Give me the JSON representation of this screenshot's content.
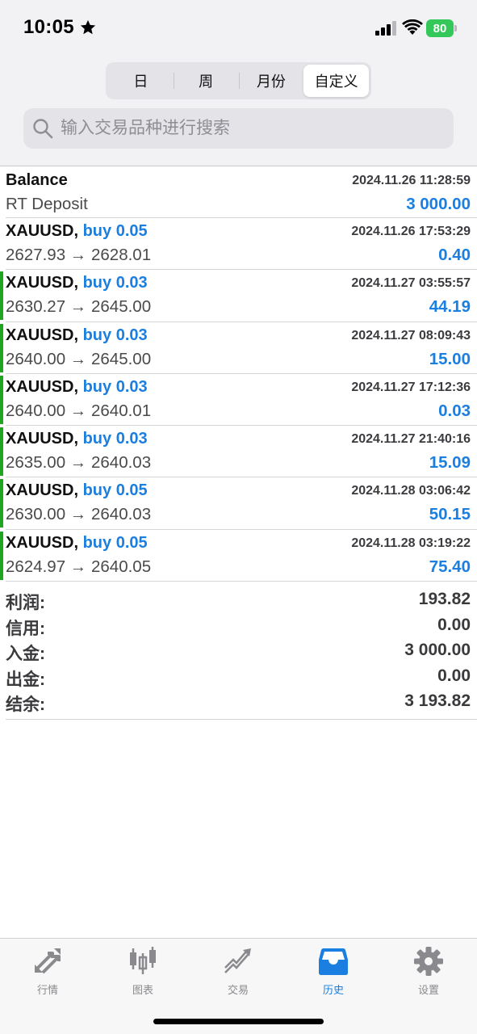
{
  "status": {
    "time": "10:05",
    "battery": "80"
  },
  "segments": [
    {
      "label": "日",
      "active": false
    },
    {
      "label": "周",
      "active": false
    },
    {
      "label": "月份",
      "active": false
    },
    {
      "label": "自定义",
      "active": true
    }
  ],
  "search": {
    "placeholder": "输入交易品种进行搜索",
    "value": ""
  },
  "balance_row": {
    "title": "Balance",
    "subtitle": "RT Deposit",
    "time": "2024.11.26 11:28:59",
    "value": "3 000.00"
  },
  "trades": [
    {
      "symbol": "XAUUSD,",
      "side": "buy 0.05",
      "prices": "2627.93 → 2628.01",
      "time": "2024.11.26 17:53:29",
      "profit": "0.40",
      "marked": false
    },
    {
      "symbol": "XAUUSD,",
      "side": "buy 0.03",
      "prices": "2630.27 → 2645.00",
      "time": "2024.11.27 03:55:57",
      "profit": "44.19",
      "marked": true
    },
    {
      "symbol": "XAUUSD,",
      "side": "buy 0.03",
      "prices": "2640.00 → 2645.00",
      "time": "2024.11.27 08:09:43",
      "profit": "15.00",
      "marked": true
    },
    {
      "symbol": "XAUUSD,",
      "side": "buy 0.03",
      "prices": "2640.00 → 2640.01",
      "time": "2024.11.27 17:12:36",
      "profit": "0.03",
      "marked": true
    },
    {
      "symbol": "XAUUSD,",
      "side": "buy 0.03",
      "prices": "2635.00 → 2640.03",
      "time": "2024.11.27 21:40:16",
      "profit": "15.09",
      "marked": true
    },
    {
      "symbol": "XAUUSD,",
      "side": "buy 0.05",
      "prices": "2630.00 → 2640.03",
      "time": "2024.11.28 03:06:42",
      "profit": "50.15",
      "marked": true
    },
    {
      "symbol": "XAUUSD,",
      "side": "buy 0.05",
      "prices": "2624.97 → 2640.05",
      "time": "2024.11.28 03:19:22",
      "profit": "75.40",
      "marked": true
    }
  ],
  "summary": [
    {
      "label": "利润:",
      "value": "193.82"
    },
    {
      "label": "信用:",
      "value": "0.00"
    },
    {
      "label": "入金:",
      "value": "3 000.00"
    },
    {
      "label": "出金:",
      "value": "0.00"
    },
    {
      "label": "结余:",
      "value": "3 193.82"
    }
  ],
  "tabs": [
    {
      "label": "行情",
      "icon": "quotes-arrows-icon",
      "active": false
    },
    {
      "label": "图表",
      "icon": "candlestick-chart-icon",
      "active": false
    },
    {
      "label": "交易",
      "icon": "trade-trend-icon",
      "active": false
    },
    {
      "label": "历史",
      "icon": "history-inbox-icon",
      "active": true
    },
    {
      "label": "设置",
      "icon": "gear-icon",
      "active": false
    }
  ],
  "colors": {
    "accent": "#1a7fe0",
    "marker": "#1fa51f",
    "inactive_icon": "#8a8a8e",
    "battery": "#34c759"
  }
}
